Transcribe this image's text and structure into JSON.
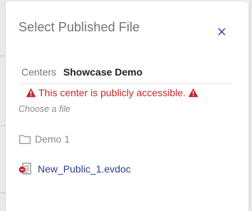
{
  "dialog": {
    "title": "Select Published File",
    "close_icon": "close-icon"
  },
  "centers": {
    "label": "Centers",
    "value": "Showcase Demo"
  },
  "warning": {
    "text": "This center is publicly accessible.",
    "icon": "warning-triangle-icon",
    "color": "#c0282d"
  },
  "choose_prompt": "Choose a file",
  "items": [
    {
      "type": "folder",
      "icon": "folder-icon",
      "label": "Demo 1"
    },
    {
      "type": "file",
      "icon": "document-file-icon",
      "label": "New_Public_1.evdoc"
    }
  ],
  "colors": {
    "link": "#2b3b8f",
    "close": "#2b3b8f",
    "title": "#737373"
  }
}
